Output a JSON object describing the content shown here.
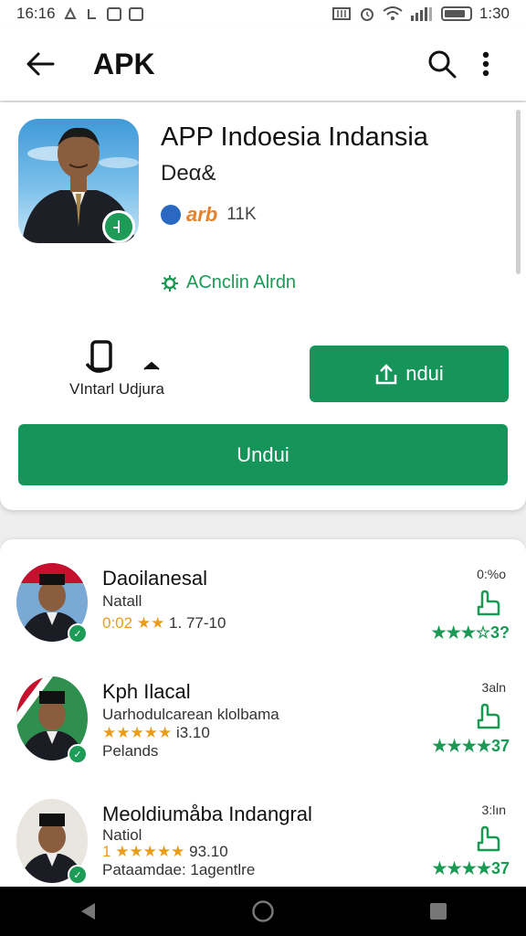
{
  "status_bar": {
    "time": "16:16",
    "right_text": "1:30"
  },
  "app_bar": {
    "title": "APK"
  },
  "app": {
    "name": "APP Indoesia Indansia",
    "developer": "Deα&",
    "rating_logo": "arb",
    "rating_count": "11K",
    "version_text": "ACnclin Alrdn",
    "share_label": "VIntarl Udjura",
    "download_small_label": "ndui",
    "download_big_label": "Undui"
  },
  "list": {
    "items": [
      {
        "name": "Daoilanesal",
        "line1": "Natall",
        "line2_prefix": "0:02",
        "line2_stars": "★★",
        "line2_suffix": "1. 77-10",
        "line3": "",
        "right_top": "0:%o",
        "rating": "★★★☆3?"
      },
      {
        "name": "Kph Ilacal",
        "line1": "Uarhodulcarean klolbama",
        "line2_prefix": "",
        "line2_stars": "★★★★★",
        "line2_suffix": "i3.10",
        "line3": "Pelands",
        "right_top": "3aln",
        "rating": "★★★★37"
      },
      {
        "name": "Meoldiumåba Indangral",
        "line1": "Natiol",
        "line2_prefix": "1",
        "line2_stars": "★★★★★",
        "line2_suffix": "93.10",
        "line3": "Pataamdae: 1agentlre",
        "right_top": "3:lın",
        "rating": "★★★★37"
      }
    ]
  },
  "colors": {
    "accent_green": "#16955a",
    "star_orange": "#e99c16",
    "rating_green": "#1a9a55"
  }
}
